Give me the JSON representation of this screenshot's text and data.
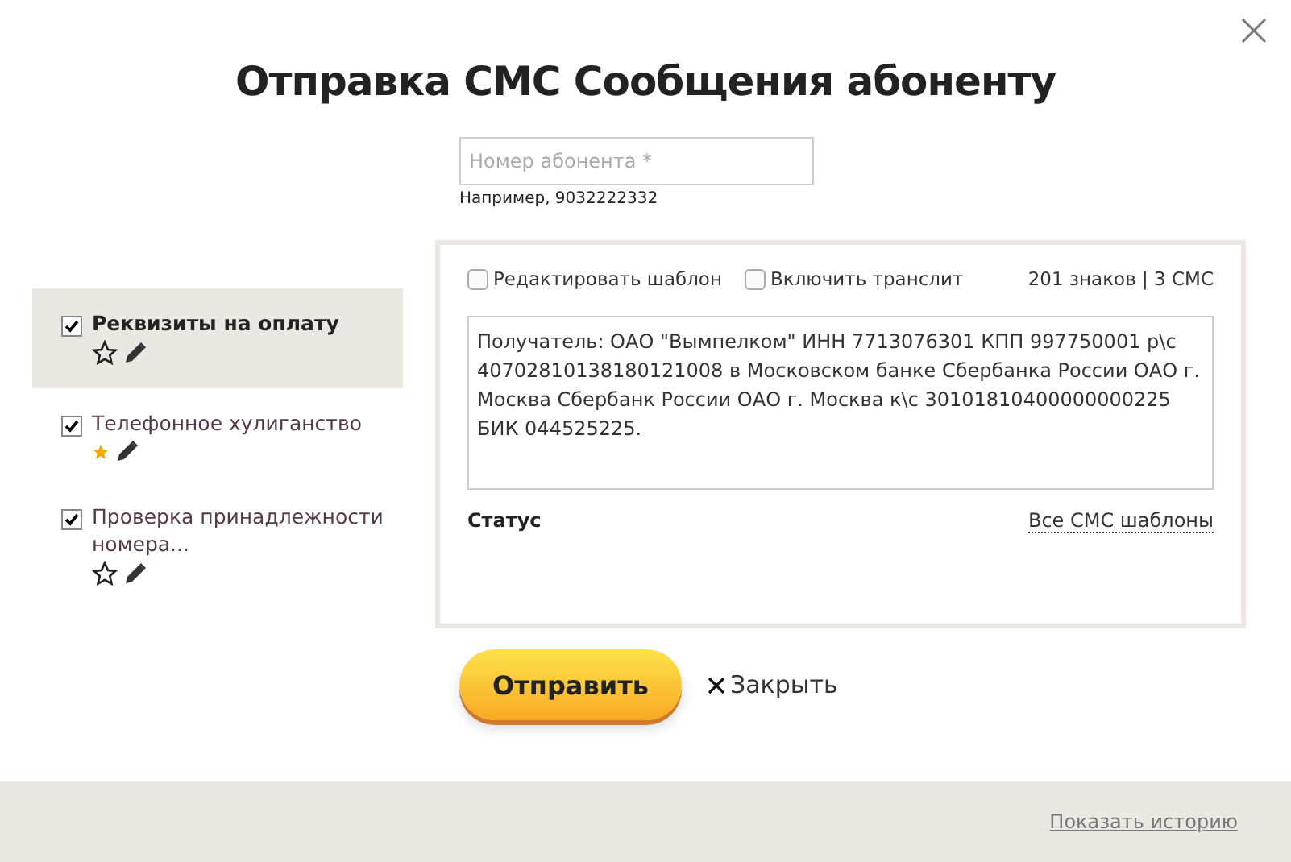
{
  "dialog": {
    "title": "Отправка СМС Сообщения абоненту"
  },
  "phone": {
    "placeholder": "Номер абонента *",
    "hint": "Например, 9032222332"
  },
  "templates": [
    {
      "label": "Реквизиты на оплату",
      "selected": true,
      "checked": true,
      "starred": false
    },
    {
      "label": "Телефонное хулиганство",
      "selected": false,
      "checked": true,
      "starred": true
    },
    {
      "label": "Проверка принадлежности номера...",
      "selected": false,
      "checked": true,
      "starred": false
    }
  ],
  "options": [
    {
      "label": "Редактировать шаблон",
      "checked": false
    },
    {
      "label": "Включить транслит",
      "checked": false
    }
  ],
  "counter": "201 знаков | 3 СМС",
  "message": "Получатель: ОАО \"Вымпелком\" ИНН 7713076301 КПП 997750001 р\\с 40702810138180121008 в Московском банке Сбербанка России ОАО г. Москва Сбербанк России ОАО г. Москва к\\с 30101810400000000225 БИК 044525225.",
  "status_label": "Статус",
  "all_templates_link": "Все СМС шаблоны",
  "send_button": "Отправить",
  "close_button": "Закрыть",
  "history_link": "Показать историю"
}
